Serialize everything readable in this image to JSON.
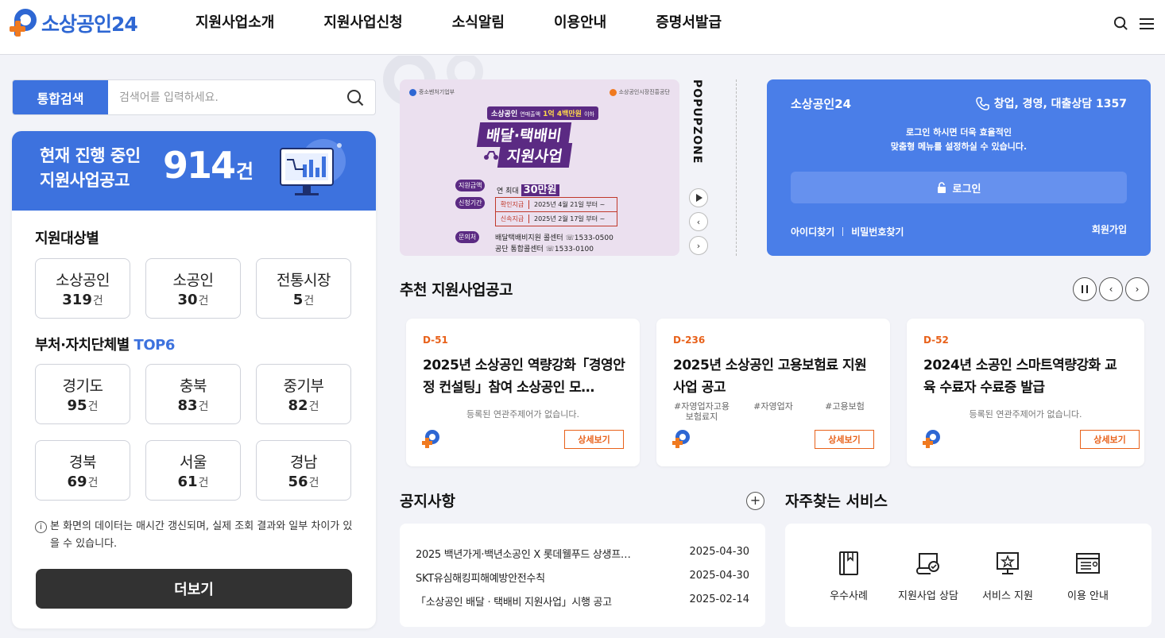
{
  "header": {
    "logo_text": "소상공인24",
    "nav": [
      "지원사업소개",
      "지원사업신청",
      "소식알림",
      "이용안내",
      "증명서발급"
    ]
  },
  "search": {
    "tab_label": "통합검색",
    "placeholder": "검색어를 입력하세요."
  },
  "summary": {
    "label": "현재 진행 중인\n지원사업공고",
    "count": "914",
    "unit": "건"
  },
  "target_section": {
    "title": "지원대상별",
    "items": [
      {
        "name": "소상공인",
        "count": "319",
        "unit": "건"
      },
      {
        "name": "소공인",
        "count": "30",
        "unit": "건"
      },
      {
        "name": "전통시장",
        "count": "5",
        "unit": "건"
      }
    ]
  },
  "ministry_section": {
    "title": "부처·자치단체별",
    "accent": "TOP6",
    "items": [
      {
        "name": "경기도",
        "count": "95",
        "unit": "건"
      },
      {
        "name": "충북",
        "count": "83",
        "unit": "건"
      },
      {
        "name": "중기부",
        "count": "82",
        "unit": "건"
      },
      {
        "name": "경북",
        "count": "69",
        "unit": "건"
      },
      {
        "name": "서울",
        "count": "61",
        "unit": "건"
      },
      {
        "name": "경남",
        "count": "56",
        "unit": "건"
      }
    ]
  },
  "data_notice": "본 화면의 데이터는 매시간 갱신되며, 실제 조회 결과와 일부 차이가 있을 수 있습니다.",
  "more_button": "더보기",
  "popup": {
    "zone_title": "POPUPZONE",
    "org_left": "중소벤처기업부",
    "org_right": "소상공인시장진흥공단",
    "tag": "소상공인",
    "tag_sub": "연매출액",
    "tag_amount": "1억 4백만원",
    "tag_tail": "이하",
    "headline1": "배달·택배비",
    "headline2": "지원사업",
    "amount_label": "지원금액",
    "amount_prefix": "연 최대",
    "amount": "30만원",
    "period_label": "신청기간",
    "period_rows": [
      {
        "type": "확인지급",
        "date": "2025년 4월 21일 부터 ~"
      },
      {
        "type": "신속지급",
        "date": "2025년 2월 17일 부터 ~"
      }
    ],
    "contact_label": "문의처",
    "contact_rows": [
      "배달택배비지원 콜센터 ☏1533-0500",
      "공단 통합콜센터 ☏1533-0100"
    ]
  },
  "login": {
    "brand": "소상공인24",
    "phone": "창업, 경영, 대출상담 1357",
    "message": "로그인 하시면 더욱 효율적인\n맞춤형 메뉴를 설정하실 수 있습니다.",
    "login_button": "로그인",
    "find_id": "아이디찾기",
    "find_pw": "비밀번호찾기",
    "signup": "회원가입"
  },
  "recommend": {
    "title": "추천 지원사업공고",
    "detail_label": "상세보기",
    "cards": [
      {
        "dday": "D-51",
        "title": "2025년 소상공인 역량강화「경영안정 컨설팅」참여 소상공인 모…",
        "empty": "등록된 연관주제어가 없습니다."
      },
      {
        "dday": "D-236",
        "title": "2025년 소상공인 고용보험료 지원사업 공고",
        "tags": [
          "#자영업자고용보험료지",
          "#자영업자",
          "#고용보험"
        ]
      },
      {
        "dday": "D-52",
        "title": "2024년 소공인 스마트역량강화 교육 수료자 수료증 발급",
        "empty": "등록된 연관주제어가 없습니다."
      }
    ]
  },
  "notices": {
    "title": "공지사항",
    "items": [
      {
        "title": "2025 백년가게·백년소공인 X 롯데웰푸드 상생프…",
        "date": "2025-04-30"
      },
      {
        "title": "SKT유심해킹피해예방안전수칙",
        "date": "2025-04-30"
      },
      {
        "title": "「소상공인 배달ㆍ택배비 지원사업」시행 공고",
        "date": "2025-02-14"
      }
    ]
  },
  "services": {
    "title": "자주찾는 서비스",
    "items": [
      {
        "label": "우수사례",
        "icon": "book-icon"
      },
      {
        "label": "지원사업 상담",
        "icon": "certificate-icon"
      },
      {
        "label": "서비스 지원",
        "icon": "star-board-icon"
      },
      {
        "label": "이용 안내",
        "icon": "document-icon"
      }
    ]
  },
  "colors": {
    "primary": "#3d72de",
    "login_bg": "#4a7ee8",
    "accent_orange": "#e8611a",
    "popup_purple": "#5b2a83"
  }
}
